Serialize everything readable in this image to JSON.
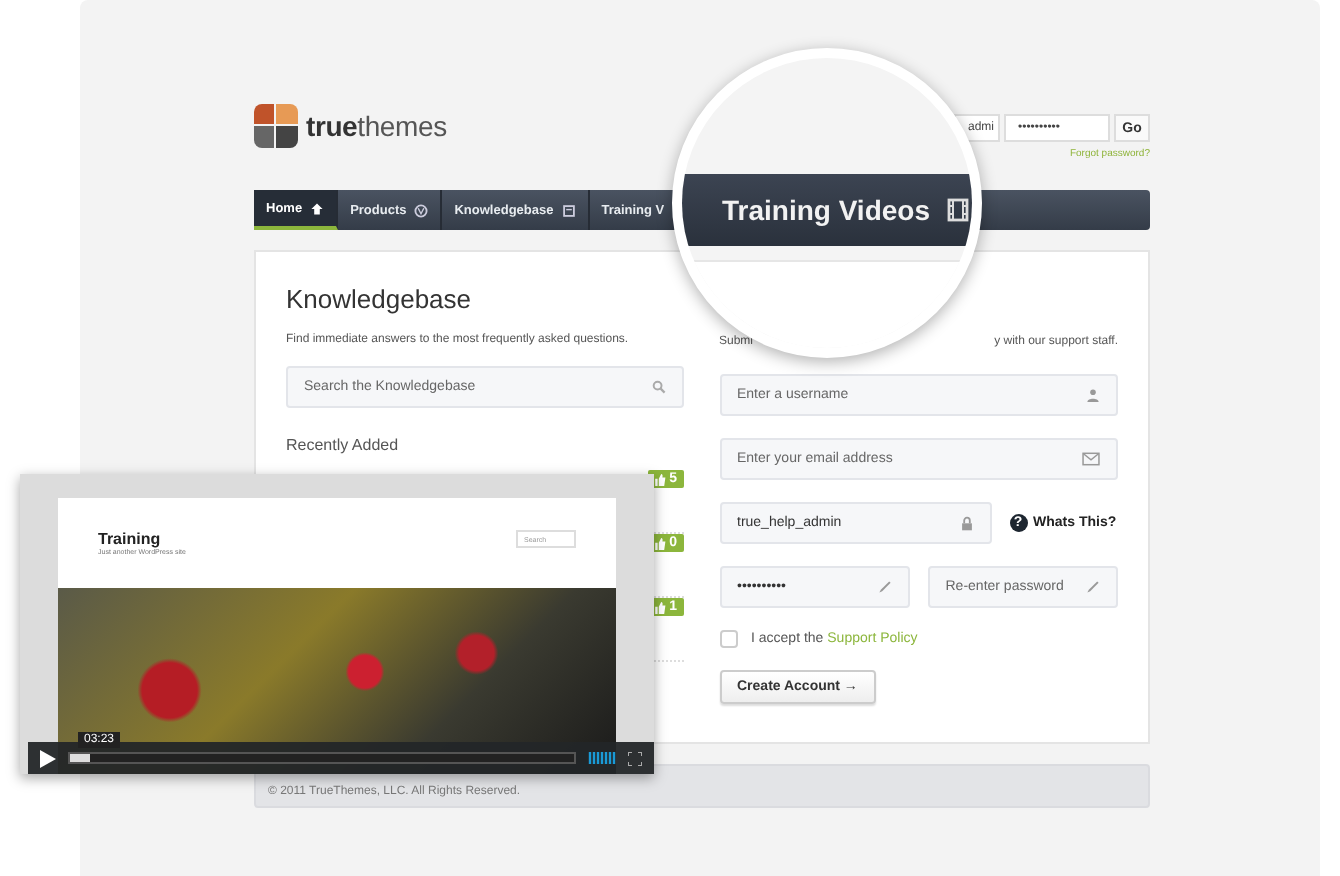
{
  "header": {
    "logo_text": "**true**themes",
    "login": {
      "username_fragment": "admi",
      "password": "••••••••••",
      "go": "Go",
      "forgot": "Forgot password?"
    }
  },
  "nav": [
    {
      "label": "Home",
      "kind": "home",
      "selected": true
    },
    {
      "label": "Products",
      "kind": "products",
      "selected": false
    },
    {
      "label": "Knowledgebase",
      "kind": "knowledgebase",
      "selected": false
    },
    {
      "label": "Training V",
      "kind": "partial",
      "selected": false
    }
  ],
  "magnifier": {
    "label": "Training Videos",
    "kind": "videos"
  },
  "knowledgebase": {
    "title": "Knowledgebase",
    "subtitle": "Find immediate answers to the most frequently asked questions.",
    "search_placeholder": "Search the Knowledgebase",
    "recent_heading": "Recently Added",
    "recent_votes": [
      "5",
      "0",
      "1"
    ]
  },
  "signup": {
    "intro_start": "Submi",
    "intro_end": "y with our support staff.",
    "username": {
      "placeholder": "Enter a username"
    },
    "email": {
      "placeholder": "Enter your email address"
    },
    "helpdesk": {
      "value": "true_help_admin",
      "help_icon": "?",
      "help_label": "Whats This?"
    },
    "password": {
      "value": "••••••••••"
    },
    "password_confirm": {
      "placeholder": "Re-enter password"
    },
    "policy": {
      "checked": false,
      "text": "I accept the ",
      "link": "Support Policy"
    },
    "submit": "Create Account →"
  },
  "footer": {
    "text": "© 2011 TrueThemes, LLC. All Rights Reserved."
  },
  "video": {
    "site_title": "Training",
    "tagline": "Just another WordPress site",
    "search_placeholder": "Search",
    "time": "03:23",
    "progress": {
      "level": 0.04
    }
  }
}
